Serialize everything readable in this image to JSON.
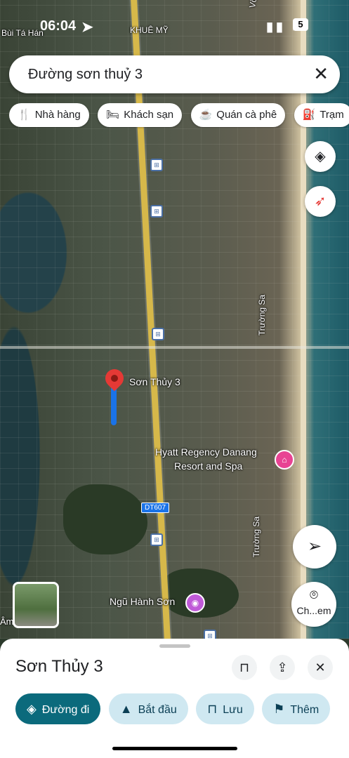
{
  "status_bar": {
    "time": "06:04",
    "battery": "5",
    "area_top": "KHUÊ MỸ",
    "left_label": "Bùi Tá Hán",
    "right_label": "Võ Nguyên Giáp"
  },
  "search": {
    "query": "Đường sơn thuỷ 3"
  },
  "chips": [
    {
      "icon": "restaurant-icon",
      "label": "Nhà hàng"
    },
    {
      "icon": "hotel-icon",
      "label": "Khách sạn"
    },
    {
      "icon": "coffee-icon",
      "label": "Quán cà phê"
    },
    {
      "icon": "gas-station-icon",
      "label": "Trạm"
    }
  ],
  "map": {
    "pin_label": "Sơn Thủy 3",
    "hotel_name": "Hyatt Regency Danang",
    "hotel_name_2": "Resort and Spa",
    "landmark": "Ngũ Hành Sơn",
    "road_shield": "DT607",
    "street_1": "Trường Sa",
    "street_2": "Trường Sa",
    "edge_label": "Âm"
  },
  "lens": {
    "label": "Ch...em"
  },
  "sheet": {
    "title": "Sơn Thủy 3",
    "actions": [
      {
        "icon": "directions-icon",
        "label": "Đường đi"
      },
      {
        "icon": "navigation-icon",
        "label": "Bắt đầu"
      },
      {
        "icon": "bookmark-icon",
        "label": "Lưu"
      },
      {
        "icon": "flag-icon",
        "label": "Thêm"
      }
    ]
  },
  "colors": {
    "primary": "#0b6a7c",
    "secondary": "#cfe8f1",
    "route": "#1a73e8",
    "pin": "#e53935"
  }
}
